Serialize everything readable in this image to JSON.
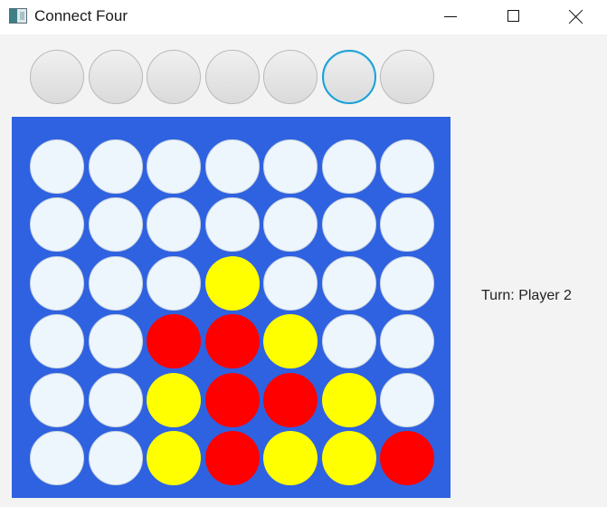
{
  "window": {
    "title": "Connect Four",
    "icon": "app-window-icon",
    "controls": [
      "minimize-icon",
      "maximize-icon",
      "close-icon"
    ]
  },
  "columns": {
    "count": 7,
    "focused_index": 5
  },
  "board": {
    "rows": 6,
    "cols": 7,
    "cells": [
      [
        "empty",
        "empty",
        "empty",
        "empty",
        "empty",
        "empty",
        "empty"
      ],
      [
        "empty",
        "empty",
        "empty",
        "empty",
        "empty",
        "empty",
        "empty"
      ],
      [
        "empty",
        "empty",
        "empty",
        "yellow",
        "empty",
        "empty",
        "empty"
      ],
      [
        "empty",
        "empty",
        "red",
        "red",
        "yellow",
        "empty",
        "empty"
      ],
      [
        "empty",
        "empty",
        "yellow",
        "red",
        "red",
        "yellow",
        "empty"
      ],
      [
        "empty",
        "empty",
        "yellow",
        "red",
        "yellow",
        "yellow",
        "red"
      ]
    ]
  },
  "colors": {
    "board": "#2f62e0",
    "empty": "#eef6fd",
    "red": "#ff0000",
    "yellow": "#ffff00",
    "focus_ring": "#1d9fd3"
  },
  "status": {
    "turn_text": "Turn: Player 2"
  }
}
